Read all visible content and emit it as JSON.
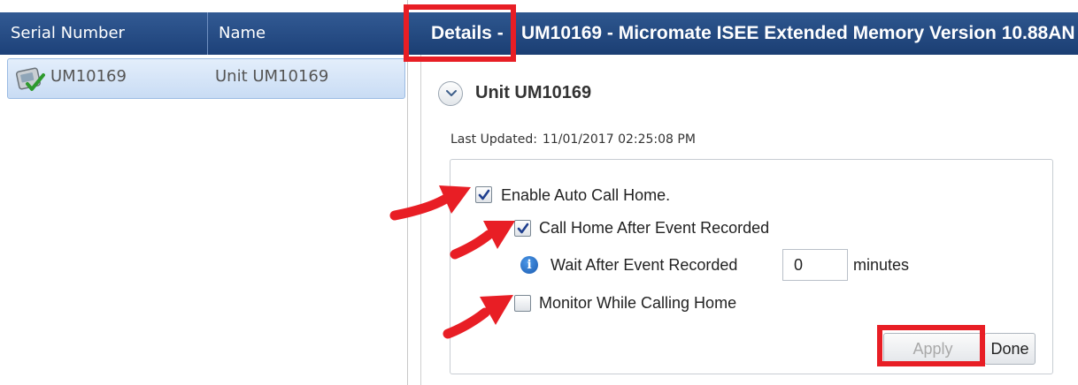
{
  "list": {
    "columns": [
      "Serial Number",
      "Name"
    ],
    "rows": [
      {
        "serial": "UM10169",
        "name": "Unit UM10169",
        "icon": "unit-device-icon"
      }
    ]
  },
  "details": {
    "label": "Details -",
    "title": "UM10169 - Micromate  ISEE Extended Memory Version 10.88AN",
    "unit_name": "Unit UM10169",
    "last_updated_label": "Last Updated:",
    "last_updated_value": "11/01/2017 02:25:08 PM"
  },
  "settings": {
    "enable_auto_call_home": {
      "label": "Enable Auto Call Home.",
      "checked": true
    },
    "call_home_after_event": {
      "label": "Call Home After Event Recorded",
      "checked": true
    },
    "wait_after_event": {
      "label": "Wait After Event Recorded",
      "value": "0",
      "unit": "minutes"
    },
    "monitor_while_calling": {
      "label": "Monitor While Calling Home",
      "checked": false
    }
  },
  "buttons": {
    "apply": "Apply",
    "done": "Done"
  },
  "colors": {
    "header_blue": "#1d4179",
    "selection": "#c9dcf4",
    "annotation_red": "#e81e25"
  }
}
